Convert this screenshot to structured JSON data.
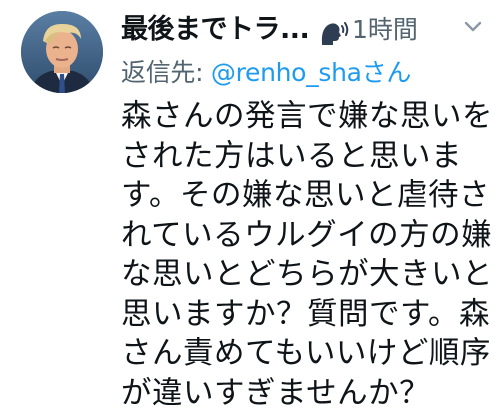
{
  "author": {
    "display_name": "最後までトラ...",
    "emoji_icon": "speaking-head-icon",
    "timestamp": "1時間"
  },
  "reply": {
    "prefix": "返信先: ",
    "mention": "@renho_shaさん"
  },
  "tweet": {
    "lines": [
      "森さんの発言で嫌な思いを",
      "された方はいると思いま",
      "す。その嫌な思いと虐待さ",
      "れているウルグイの方の嫌",
      "な思いとどちらが大きいと",
      "思いますか？質問です。森",
      "さん責めてもいいけど順序",
      "が違いすぎませんか？"
    ]
  },
  "colors": {
    "secondary_text": "#536471",
    "mention": "#1d9bf0",
    "primary_text": "#0f1419"
  }
}
